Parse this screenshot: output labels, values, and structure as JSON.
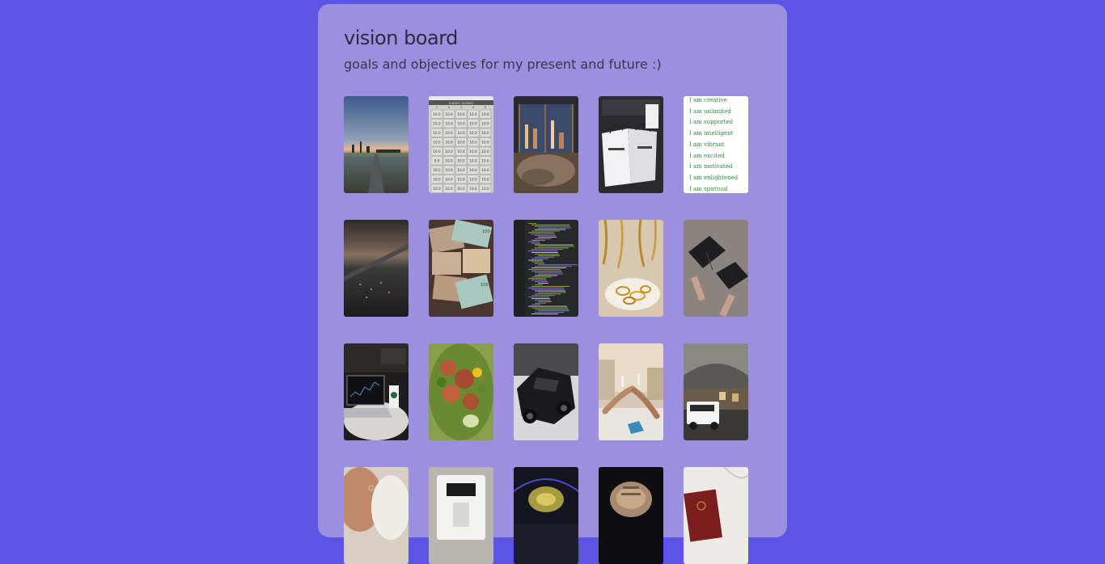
{
  "header": {
    "title": "vision board",
    "subtitle": "goals and objectives for my present and future :)"
  },
  "affirmations": [
    "I am creative",
    "I am unlimited",
    "I am supported",
    "I am intelligent",
    "I am vibrant",
    "I am excited",
    "I am motivated",
    "I am enlightened",
    "I am spiritual"
  ],
  "scoreboard": {
    "header": "JUDGES' SCORES",
    "columns": [
      "1",
      "2",
      "3",
      "4",
      "5"
    ],
    "rows": [
      [
        "10.0",
        "10.0",
        "10.0",
        "10.0",
        "10.0"
      ],
      [
        "10.0",
        "10.0",
        "10.0",
        "10.0",
        "10.0"
      ],
      [
        "10.0",
        "10.0",
        "10.0",
        "10.0",
        "10.0"
      ],
      [
        "10.0",
        "10.0",
        "10.0",
        "10.0",
        "10.0"
      ],
      [
        "10.0",
        "10.0",
        "10.0",
        "10.0",
        "10.0"
      ],
      [
        "9.0",
        "10.0",
        "10.0",
        "10.0",
        "10.0"
      ],
      [
        "10.0",
        "10.0",
        "10.0",
        "10.0",
        "10.0"
      ],
      [
        "10.0",
        "10.0",
        "10.0",
        "10.0",
        "10.0"
      ],
      [
        "10.0",
        "10.0",
        "10.0",
        "10.0",
        "10.0"
      ]
    ]
  },
  "banknote_label": "100",
  "images": [
    "city-sunset-photo",
    "scoreboard-photo",
    "city-night-bedroom-photo",
    "shopping-bags-photo",
    "affirmations-list",
    "airplane-window-photo",
    "cash-stacks-photo",
    "code-editor-photo",
    "gold-jewelry-photo",
    "graduation-caps-photo",
    "laptop-coffee-photo",
    "salad-plate-photo",
    "luxury-car-photo",
    "toast-hands-photo",
    "suv-parking-photo",
    "portrait-photo",
    "coffee-machine-photo",
    "car-dashboard-photo",
    "money-fan-photo",
    "passport-photo"
  ]
}
